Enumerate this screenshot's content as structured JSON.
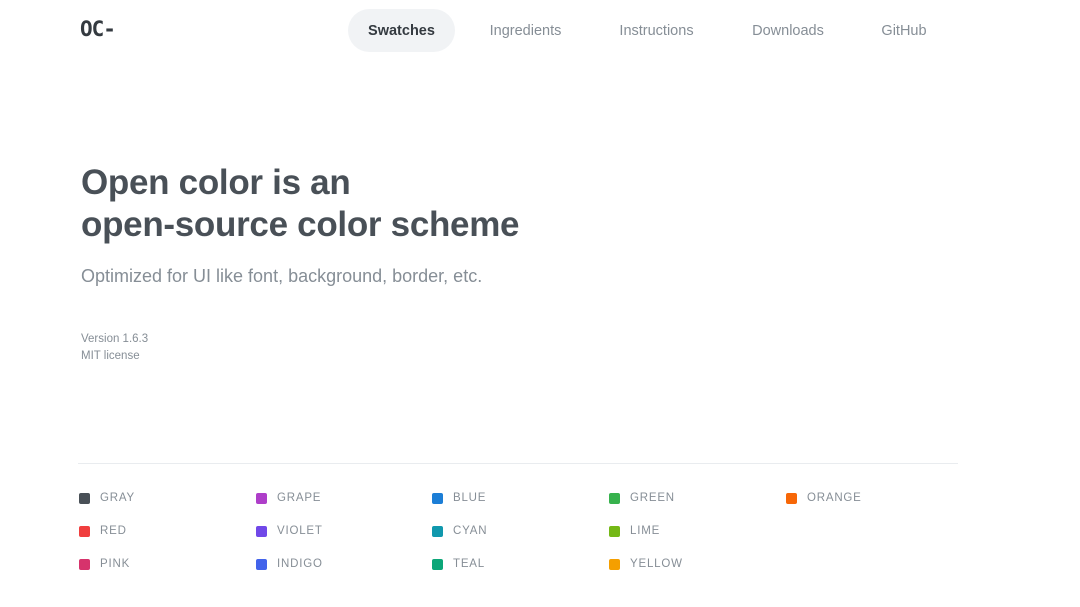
{
  "logo": "OC-",
  "nav": [
    {
      "label": "Swatches",
      "active": true
    },
    {
      "label": "Ingredients",
      "active": false
    },
    {
      "label": "Instructions",
      "active": false
    },
    {
      "label": "Downloads",
      "active": false
    },
    {
      "label": "GitHub",
      "active": false
    }
  ],
  "hero": {
    "title_line1": "Open color is an",
    "title_line2": "open-source color scheme",
    "subtitle": "Optimized for UI like font, background, border, etc.",
    "version": "Version 1.6.3",
    "license": "MIT license"
  },
  "swatches": [
    {
      "name": "GRAY",
      "color": "#495057",
      "col": 0,
      "row": 0
    },
    {
      "name": "RED",
      "color": "#f03e3e",
      "col": 0,
      "row": 1
    },
    {
      "name": "PINK",
      "color": "#d6336c",
      "col": 0,
      "row": 2
    },
    {
      "name": "GRAPE",
      "color": "#ae3ec9",
      "col": 1,
      "row": 0
    },
    {
      "name": "VIOLET",
      "color": "#7048e8",
      "col": 1,
      "row": 1
    },
    {
      "name": "INDIGO",
      "color": "#4263eb",
      "col": 1,
      "row": 2
    },
    {
      "name": "BLUE",
      "color": "#1c7ed6",
      "col": 2,
      "row": 0
    },
    {
      "name": "CYAN",
      "color": "#1098ad",
      "col": 2,
      "row": 1
    },
    {
      "name": "TEAL",
      "color": "#0ca678",
      "col": 2,
      "row": 2
    },
    {
      "name": "GREEN",
      "color": "#37b24d",
      "col": 3,
      "row": 0
    },
    {
      "name": "LIME",
      "color": "#74b816",
      "col": 3,
      "row": 1
    },
    {
      "name": "YELLOW",
      "color": "#f59f00",
      "col": 3,
      "row": 2
    },
    {
      "name": "ORANGE",
      "color": "#f76707",
      "col": 4,
      "row": 0
    }
  ]
}
